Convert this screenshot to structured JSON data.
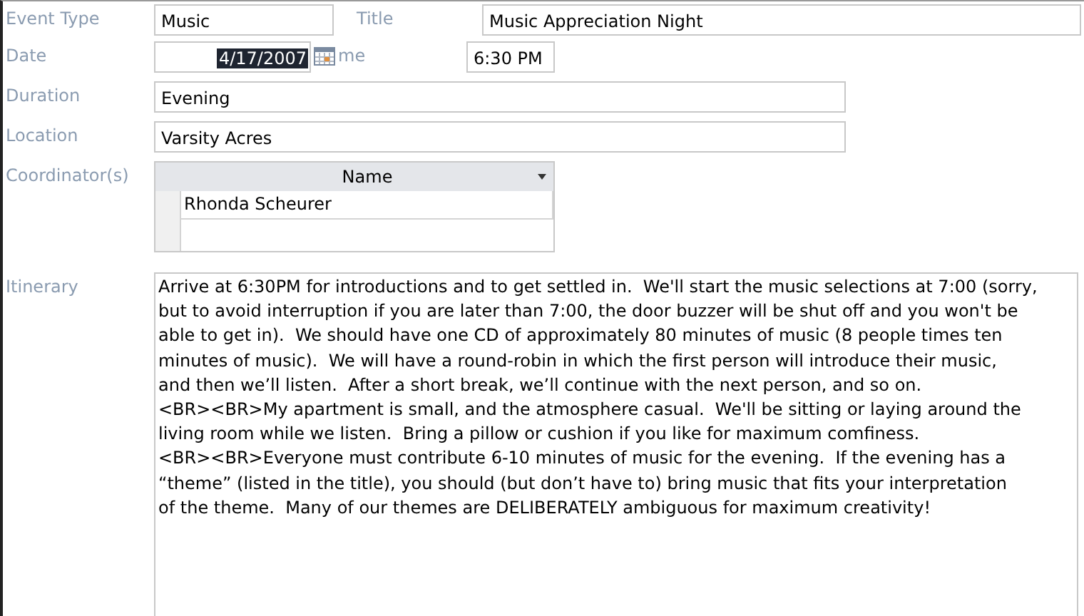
{
  "event_type": {
    "label": "Event Type",
    "value": "Music"
  },
  "title": {
    "label": "Title",
    "value": "Music Appreciation Night"
  },
  "date": {
    "label": "Date",
    "value": "4/17/2007",
    "selected": true
  },
  "time": {
    "label": "me",
    "value": "6:30 PM"
  },
  "duration": {
    "label": "Duration",
    "value": "Evening"
  },
  "location": {
    "label": "Location",
    "value": "Varsity Acres"
  },
  "coordinators": {
    "label": "Coordinator(s)",
    "columns": [
      "Name"
    ],
    "rows": [
      [
        "Rhonda Scheurer"
      ]
    ]
  },
  "itinerary": {
    "label": "Itinerary",
    "lines": [
      "Arrive at 6:30PM for introductions and to get settled in.  We'll start the music selections at 7:00 (sorry,",
      "but to avoid interruption if you are later than 7:00, the door buzzer will be shut off and you won't be",
      "able to get in).  We should have one CD of approximately 80 minutes of music (8 people times ten",
      "minutes of music).  We will have a round-robin in which the first person will introduce their music,",
      "and then we’ll listen.  After a short break, we’ll continue with the next person, and so on.",
      "<BR><BR>My apartment is small, and the atmosphere casual.  We'll be sitting or laying around the",
      "living room while we listen.  Bring a pillow or cushion if you like for maximum comfiness.",
      "<BR><BR>Everyone must contribute 6-10 minutes of music for the evening.  If the evening has a",
      "“theme” (listed in the title), you should (but don’t have to) bring music that fits your interpretation",
      "of the theme.  Many of our themes are DELIBERATELY ambiguous for maximum creativity!"
    ]
  }
}
